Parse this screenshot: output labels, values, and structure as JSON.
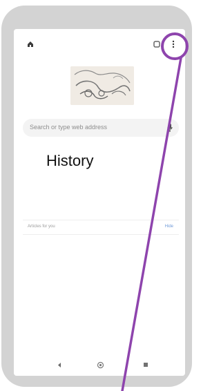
{
  "browser": {
    "search_placeholder": "Search or type web address",
    "articles_label": "Articles for you",
    "articles_action": "Hide",
    "icons": {
      "home": "home-icon",
      "tabs": "tab-switcher-icon",
      "menu": "more-vert-icon",
      "mic": "microphone-icon"
    }
  },
  "overlay": {
    "label": "History",
    "highlight_color": "#8e44ad"
  },
  "system_nav": {
    "icons": [
      "back-icon",
      "home-nav-icon",
      "recents-icon"
    ]
  }
}
